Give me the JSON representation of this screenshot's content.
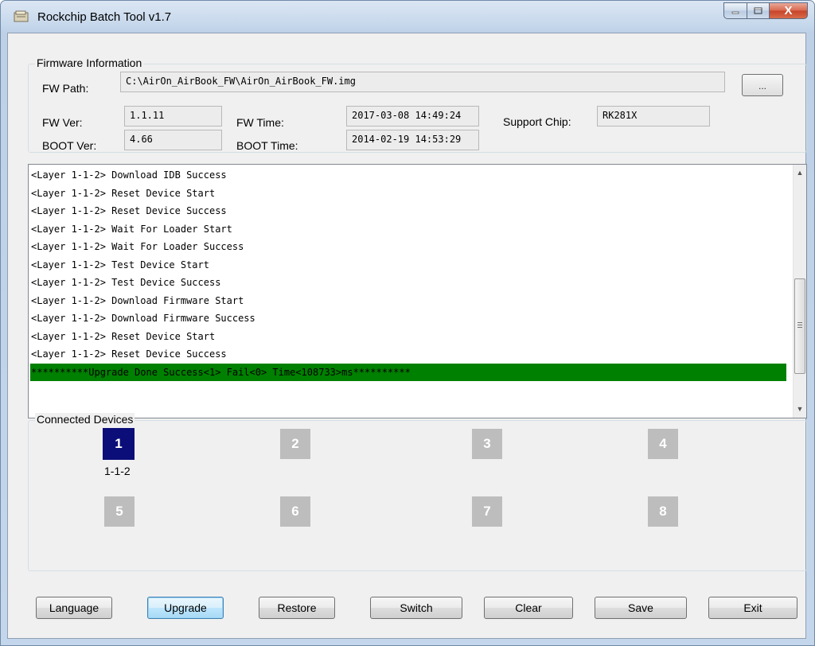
{
  "window": {
    "title": "Rockchip Batch Tool v1.7",
    "close_glyph": "X"
  },
  "firmware": {
    "group_title": "Firmware Information",
    "fw_path_label": "FW Path:",
    "fw_path": "C:\\AirOn_AirBook_FW\\AirOn_AirBook_FW.img",
    "browse_label": "...",
    "fw_ver_label": "FW Ver:",
    "fw_ver": "1.1.11",
    "fw_time_label": "FW Time:",
    "fw_time": "2017-03-08 14:49:24",
    "support_chip_label": "Support Chip:",
    "support_chip": "RK281X",
    "boot_ver_label": "BOOT Ver:",
    "boot_ver": "4.66",
    "boot_time_label": "BOOT Time:",
    "boot_time": "2014-02-19 14:53:29"
  },
  "log": {
    "lines": [
      "<Layer 1-1-2> Download IDB Success",
      "<Layer 1-1-2> Reset Device Start",
      "<Layer 1-1-2> Reset Device Success",
      "<Layer 1-1-2> Wait For Loader Start",
      "<Layer 1-1-2> Wait For Loader Success",
      "<Layer 1-1-2> Test Device Start",
      "<Layer 1-1-2> Test Device Success",
      "<Layer 1-1-2> Download Firmware Start",
      "<Layer 1-1-2> Download Firmware Success",
      "<Layer 1-1-2> Reset Device Start",
      "<Layer 1-1-2> Reset Device Success",
      "**********Upgrade Done Success<1> Fail<0> Time<108733>ms**********"
    ],
    "highlight_color": "#008000"
  },
  "devices": {
    "group_title": "Connected Devices",
    "items": [
      {
        "number": "1",
        "layer": "1-1-2",
        "active": true
      },
      {
        "number": "2",
        "layer": "",
        "active": false
      },
      {
        "number": "3",
        "layer": "",
        "active": false
      },
      {
        "number": "4",
        "layer": "",
        "active": false
      },
      {
        "number": "5",
        "layer": "",
        "active": false
      },
      {
        "number": "6",
        "layer": "",
        "active": false
      },
      {
        "number": "7",
        "layer": "",
        "active": false
      },
      {
        "number": "8",
        "layer": "",
        "active": false
      }
    ],
    "active_color": "#0b0d78",
    "inactive_color": "#bdbdbd"
  },
  "buttons": {
    "language": "Language",
    "upgrade": "Upgrade",
    "restore": "Restore",
    "switch": "Switch",
    "clear": "Clear",
    "save": "Save",
    "exit": "Exit"
  }
}
